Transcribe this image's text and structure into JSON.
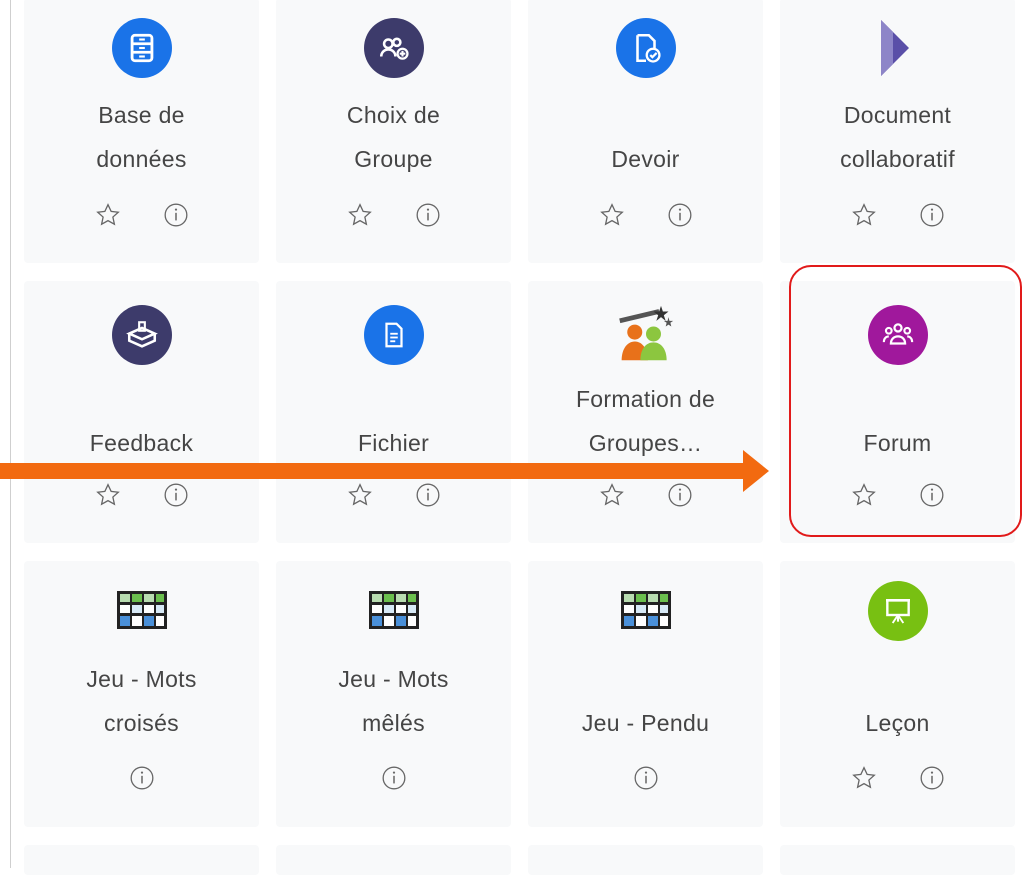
{
  "activities": [
    {
      "name": "Base de données",
      "line1": "Base de",
      "line2": "données",
      "icon": "database-icon",
      "color": "#1a73e8",
      "star": true
    },
    {
      "name": "Choix de Groupe",
      "line1": "Choix de",
      "line2": "Groupe",
      "icon": "group-choice-icon",
      "color": "#3d3b6b",
      "star": true
    },
    {
      "name": "Devoir",
      "line1": "",
      "line2": "Devoir",
      "icon": "assignment-icon",
      "color": "#1a73e8",
      "star": true
    },
    {
      "name": "Document collaboratif",
      "line1": "Document",
      "line2": "collaboratif",
      "icon": "etherpad-icon",
      "color": "#5a4fa8",
      "star": true
    },
    {
      "name": "Feedback",
      "line1": "",
      "line2": "Feedback",
      "icon": "feedback-icon",
      "color": "#3d3b6b",
      "star": true
    },
    {
      "name": "Fichier",
      "line1": "",
      "line2": "Fichier",
      "icon": "file-icon",
      "color": "#1a73e8",
      "star": true
    },
    {
      "name": "Formation de Groupes…",
      "line1": "Formation de",
      "line2": "Groupes…",
      "icon": "group-formation-icon",
      "color": "#e8711a",
      "star": true
    },
    {
      "name": "Forum",
      "line1": "",
      "line2": "Forum",
      "icon": "forum-icon",
      "color": "#a0189c",
      "star": true
    },
    {
      "name": "Jeu - Mots croisés",
      "line1": "Jeu - Mots",
      "line2": "croisés",
      "icon": "crossword-icon",
      "color": "#2e7bd6",
      "star": false
    },
    {
      "name": "Jeu - Mots mêlés",
      "line1": "Jeu - Mots",
      "line2": "mêlés",
      "icon": "wordsearch-icon",
      "color": "#2e7bd6",
      "star": false
    },
    {
      "name": "Jeu - Pendu",
      "line1": "",
      "line2": "Jeu - Pendu",
      "icon": "hangman-icon",
      "color": "#2e7bd6",
      "star": false
    },
    {
      "name": "Leçon",
      "line1": "",
      "line2": "Leçon",
      "icon": "lesson-icon",
      "color": "#78c012",
      "star": true
    }
  ],
  "annotations": {
    "highlight_color": "#e11a1a",
    "arrow_color": "#f26a10",
    "highlighted": "Forum"
  },
  "icons": {
    "star": "star-outline-icon",
    "info": "info-icon"
  }
}
